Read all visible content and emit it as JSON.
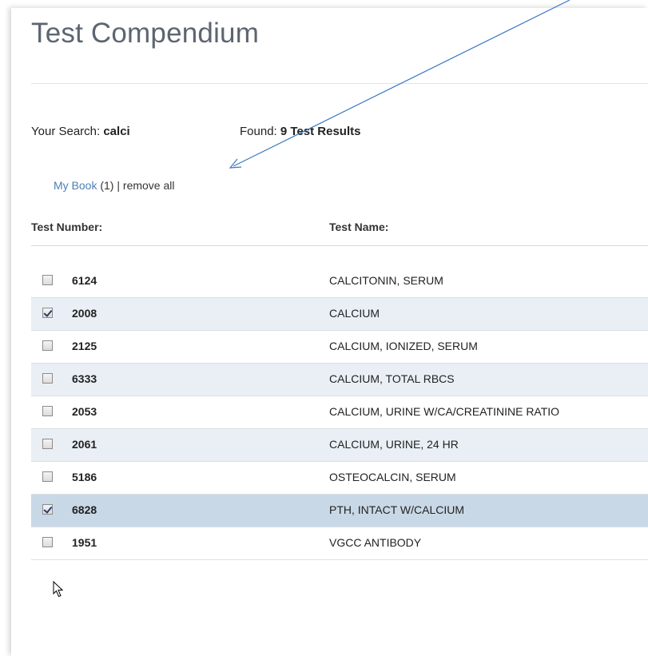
{
  "page": {
    "title": "Test Compendium"
  },
  "search": {
    "label": "Your Search:",
    "query": "calci",
    "found_label": "Found:",
    "found_count": "9",
    "found_suffix": "Test Results"
  },
  "mybook": {
    "link_label": "My Book",
    "count": "(1)",
    "separator": "|",
    "remove_label": "remove all"
  },
  "columns": {
    "number": "Test Number:",
    "name": "Test Name:"
  },
  "results": [
    {
      "number": "6124",
      "name": "CALCITONIN, SERUM",
      "checked": false
    },
    {
      "number": "2008",
      "name": "CALCIUM",
      "checked": true
    },
    {
      "number": "2125",
      "name": "CALCIUM, IONIZED, SERUM",
      "checked": false
    },
    {
      "number": "6333",
      "name": "CALCIUM, TOTAL RBCS",
      "checked": false
    },
    {
      "number": "2053",
      "name": "CALCIUM, URINE W/CA/CREATININE RATIO",
      "checked": false
    },
    {
      "number": "2061",
      "name": "CALCIUM, URINE, 24 HR",
      "checked": false
    },
    {
      "number": "5186",
      "name": "OSTEOCALCIN, SERUM",
      "checked": false
    },
    {
      "number": "6828",
      "name": "PTH, INTACT W/CALCIUM",
      "checked": true
    },
    {
      "number": "1951",
      "name": "VGCC ANTIBODY",
      "checked": false
    }
  ],
  "colors": {
    "title": "#5d6570",
    "link": "#4d7fb3",
    "row_shade": "#e9eff5",
    "row_active": "#c9d8e6",
    "annotation_arrow": "#3b79c4"
  },
  "icons": {
    "annotation": "arrow-icon",
    "pointer": "mouse-cursor-icon"
  }
}
